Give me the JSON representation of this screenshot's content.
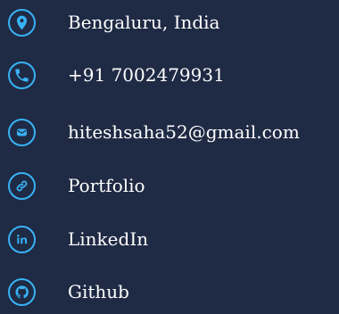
{
  "contacts": {
    "location": "Bengaluru, India",
    "phone": "+91 7002479931",
    "email": "hiteshsaha52@gmail.com",
    "portfolio": "Portfolio",
    "linkedin": "LinkedIn",
    "github": "Github"
  },
  "icons": {
    "location": "location-pin-icon",
    "phone": "phone-icon",
    "email": "email-icon",
    "portfolio": "link-icon",
    "linkedin": "linkedin-icon",
    "github": "github-icon"
  },
  "colors": {
    "background": "#1f2a44",
    "accent": "#38b2f5",
    "text": "#ffffff"
  }
}
